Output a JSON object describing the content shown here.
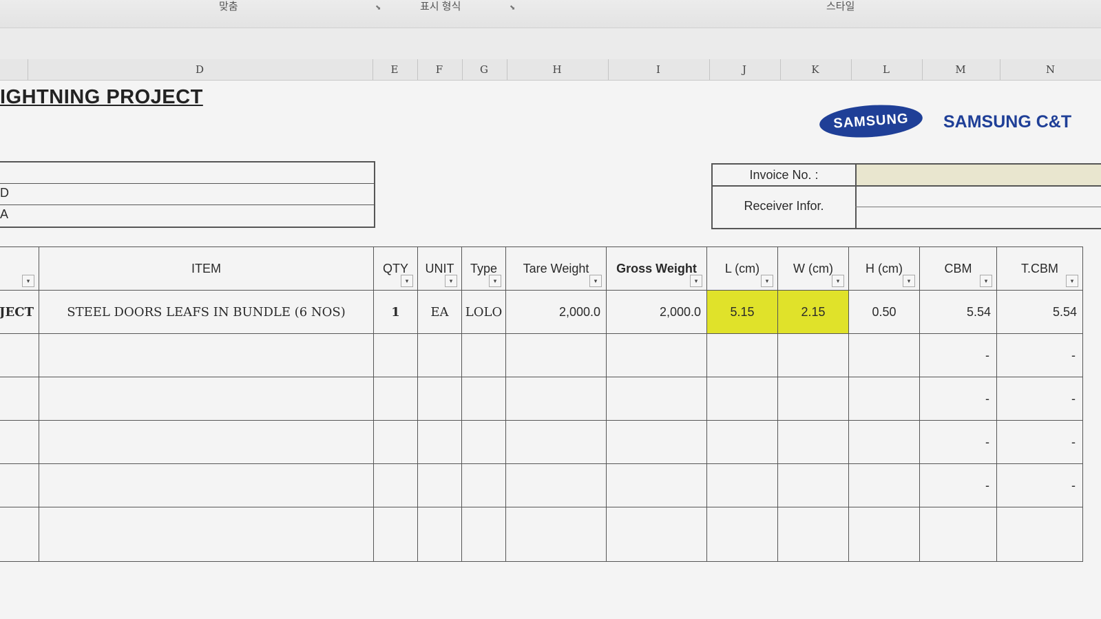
{
  "ribbon": {
    "group_left": "맞춤",
    "group_middle": "표시 형식",
    "group_right": "스타일"
  },
  "column_headers": [
    "D",
    "E",
    "F",
    "G",
    "H",
    "I",
    "J",
    "K",
    "L",
    "M",
    "N"
  ],
  "sheet": {
    "title": "IGHTNING PROJECT",
    "logo_text": "SAMSUNG",
    "brand": "SAMSUNG C&T",
    "left_box_labels": [
      "D",
      "A"
    ],
    "invoice_label": "Invoice No. :",
    "receiver_label": "Receiver Infor."
  },
  "table": {
    "headers": [
      "ITEM",
      "QTY",
      "UNIT",
      "Type",
      "Tare Weight",
      "Gross Weight",
      "L (cm)",
      "W (cm)",
      "H (cm)",
      "CBM",
      "T.CBM"
    ],
    "row1": {
      "prefix": "JECT",
      "item": "STEEL DOORS LEAFS  IN BUNDLE (6 NOS)",
      "qty": "1",
      "unit": "EA",
      "type": "LOLO",
      "tare_weight": "2,000.0",
      "gross_weight": "2,000.0",
      "l": "5.15",
      "w": "2.15",
      "h": "0.50",
      "cbm": "5.54",
      "tcbm": "5.54"
    },
    "empty_dash": "-"
  },
  "colors": {
    "highlight": "#e0e22a",
    "brand_blue": "#1f3f97"
  }
}
